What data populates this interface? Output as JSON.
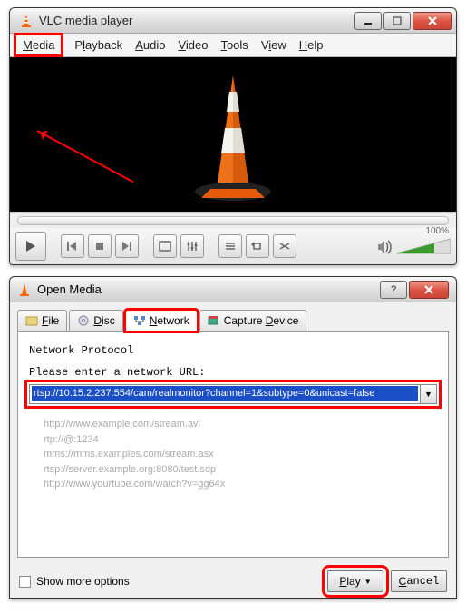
{
  "main_window": {
    "title": "VLC media player",
    "menu": {
      "media": "Media",
      "playback": "Playback",
      "audio": "Audio",
      "video": "Video",
      "tools": "Tools",
      "view": "View",
      "help": "Help"
    },
    "volume_label": "100%"
  },
  "dialog": {
    "title": "Open Media",
    "tabs": {
      "file": "File",
      "disc": "Disc",
      "network": "Network",
      "capture": "Capture Device"
    },
    "network_panel": {
      "heading": "Network Protocol",
      "prompt": "Please enter a network URL:",
      "url_value": "rtsp://10.15.2.237:554/cam/realmonitor?channel=1&subtype=0&unicast=false",
      "examples": [
        "http://www.example.com/stream.avi",
        "rtp://@:1234",
        "mms://mms.examples.com/stream.asx",
        "rtsp://server.example.org:8080/test.sdp",
        "http://www.yourtube.com/watch?v=gg64x"
      ]
    },
    "show_more": "Show more options",
    "play": "Play",
    "cancel": "Cancel"
  }
}
